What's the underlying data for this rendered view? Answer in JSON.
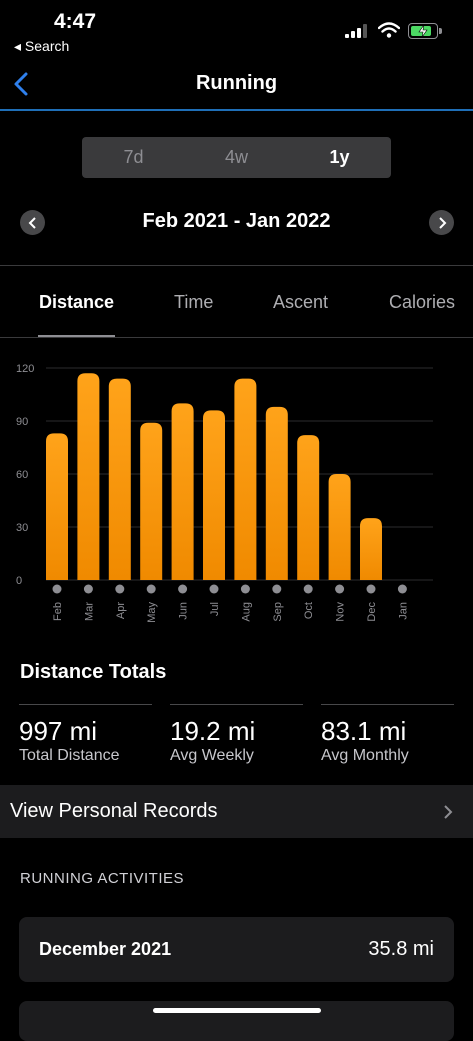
{
  "status_bar": {
    "time": "4:47",
    "back_label": "◂ Search"
  },
  "nav": {
    "title": "Running"
  },
  "range_tabs": [
    {
      "label": "7d"
    },
    {
      "label": "4w"
    },
    {
      "label": "1y",
      "active": true
    }
  ],
  "date_range": "Feb 2021 - Jan 2022",
  "metric_tabs": [
    {
      "label": "Distance",
      "active": true
    },
    {
      "label": "Time"
    },
    {
      "label": "Ascent"
    },
    {
      "label": "Calories"
    }
  ],
  "chart_data": {
    "type": "bar",
    "categories": [
      "Feb",
      "Mar",
      "Apr",
      "May",
      "Jun",
      "Jul",
      "Aug",
      "Sep",
      "Oct",
      "Nov",
      "Dec",
      "Jan"
    ],
    "values": [
      83,
      117,
      114,
      89,
      100,
      96,
      114,
      98,
      82,
      60,
      35,
      0
    ],
    "y_ticks": [
      0,
      30,
      60,
      90,
      120
    ],
    "ylim": [
      0,
      120
    ],
    "grid": true,
    "bar_color_top": "#ffa31a",
    "bar_color_bottom": "#f08a00",
    "dot_color": "#8e8e93"
  },
  "totals": {
    "title": "Distance Totals",
    "stats": [
      {
        "value": "997 mi",
        "label": "Total Distance"
      },
      {
        "value": "19.2 mi",
        "label": "Avg Weekly"
      },
      {
        "value": "83.1 mi",
        "label": "Avg Monthly"
      }
    ]
  },
  "records": {
    "label": "View Personal Records"
  },
  "activities": {
    "header": "RUNNING ACTIVITIES",
    "items": [
      {
        "title": "December 2021",
        "value": "35.8 mi"
      }
    ]
  },
  "colors": {
    "accent_blue": "#2f80ed",
    "bar_orange": "#ff9500"
  }
}
